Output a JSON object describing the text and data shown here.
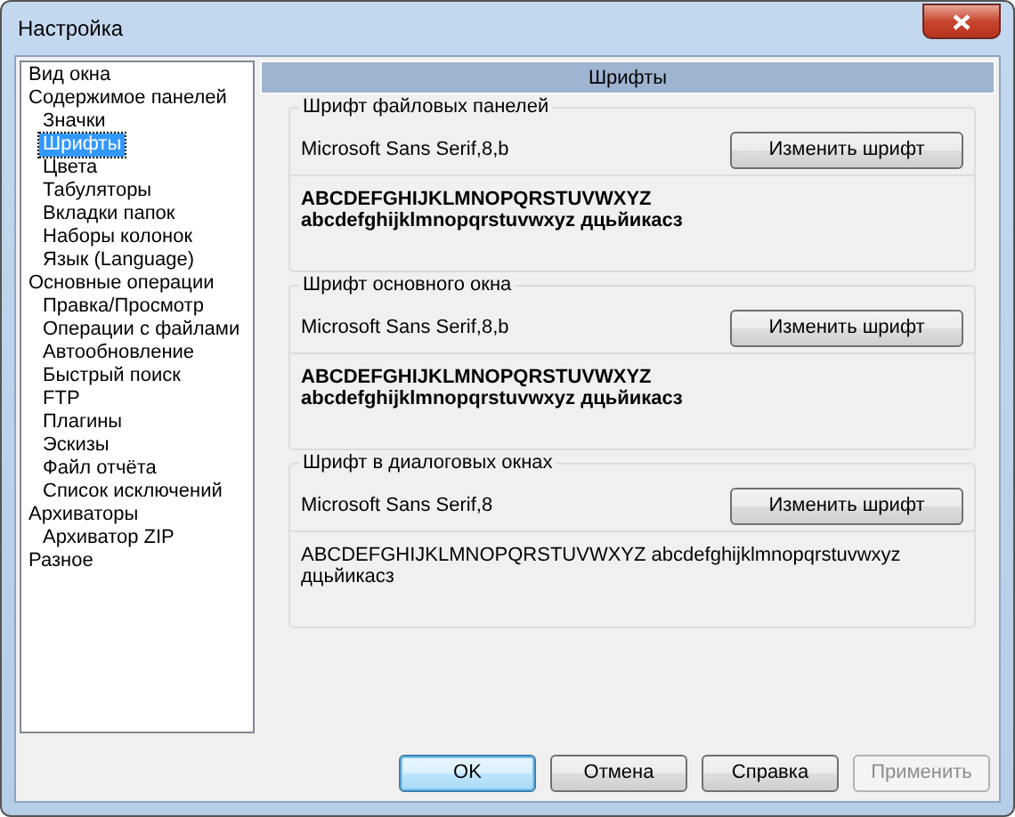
{
  "window": {
    "title": "Настройка"
  },
  "sidebar": {
    "items": [
      {
        "label": "Вид окна",
        "selected": false
      },
      {
        "label": "Содержимое панелей",
        "selected": false,
        "children": [
          {
            "label": "Значки",
            "selected": false
          },
          {
            "label": "Шрифты",
            "selected": true
          },
          {
            "label": "Цвета",
            "selected": false
          },
          {
            "label": "Табуляторы",
            "selected": false
          },
          {
            "label": "Вкладки папок",
            "selected": false
          },
          {
            "label": "Наборы колонок",
            "selected": false
          },
          {
            "label": "Язык (Language)",
            "selected": false
          }
        ]
      },
      {
        "label": "Основные операции",
        "selected": false,
        "children": [
          {
            "label": "Правка/Просмотр",
            "selected": false
          },
          {
            "label": "Операции с файлами",
            "selected": false
          },
          {
            "label": "Автообновление",
            "selected": false
          },
          {
            "label": "Быстрый поиск",
            "selected": false
          },
          {
            "label": "FTP",
            "selected": false
          },
          {
            "label": "Плагины",
            "selected": false
          },
          {
            "label": "Эскизы",
            "selected": false
          },
          {
            "label": "Файл отчёта",
            "selected": false
          },
          {
            "label": "Список исключений",
            "selected": false
          }
        ]
      },
      {
        "label": "Архиваторы",
        "selected": false,
        "children": [
          {
            "label": "Архиватор ZIP",
            "selected": false
          }
        ]
      },
      {
        "label": "Разное",
        "selected": false
      }
    ]
  },
  "panel": {
    "title": "Шрифты",
    "groups": [
      {
        "title": "Шрифт файловых панелей",
        "font": "Microsoft Sans Serif,8,b",
        "button": "Изменить шрифт",
        "bold": true,
        "sample": [
          "ABCDEFGHIJKLMNOPQRSTUVWXYZ",
          "abcdefghijklmnopqrstuvwxyz дцьйикасз"
        ]
      },
      {
        "title": "Шрифт основного окна",
        "font": "Microsoft Sans Serif,8,b",
        "button": "Изменить шрифт",
        "bold": true,
        "sample": [
          "ABCDEFGHIJKLMNOPQRSTUVWXYZ",
          "abcdefghijklmnopqrstuvwxyz дцьйикасз"
        ]
      },
      {
        "title": "Шрифт в диалоговых окнах",
        "font": "Microsoft Sans Serif,8",
        "button": "Изменить шрифт",
        "bold": false,
        "sample": [
          "ABCDEFGHIJKLMNOPQRSTUVWXYZ abcdefghijklmnopqrstuvwxyz дцьйикасз"
        ]
      }
    ]
  },
  "buttons": [
    {
      "label": "OK",
      "kind": "default",
      "disabled": false
    },
    {
      "label": "Отмена",
      "kind": "normal",
      "disabled": false
    },
    {
      "label": "Справка",
      "kind": "normal",
      "disabled": false
    },
    {
      "label": "Применить",
      "kind": "normal",
      "disabled": true
    }
  ]
}
